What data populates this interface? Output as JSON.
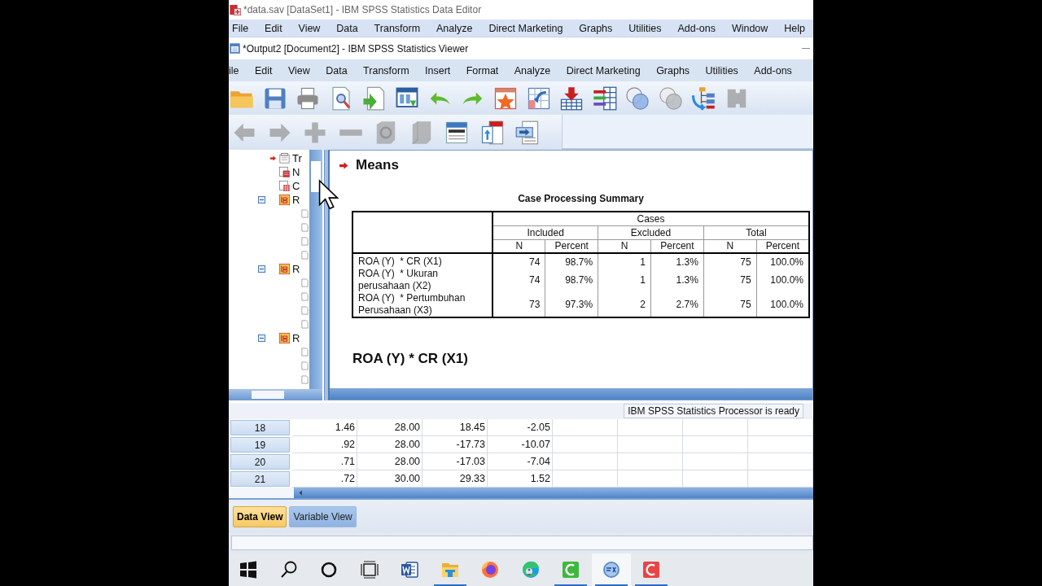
{
  "editor": {
    "title": "*data.sav [DataSet1] - IBM SPSS Statistics Data Editor",
    "menu": [
      "File",
      "Edit",
      "View",
      "Data",
      "Transform",
      "Analyze",
      "Direct Marketing",
      "Graphs",
      "Utilities",
      "Add-ons",
      "Window",
      "Help"
    ]
  },
  "viewer": {
    "title": "*Output2 [Document2] - IBM SPSS Statistics Viewer",
    "menu": [
      "ile",
      "Edit",
      "View",
      "Data",
      "Transform",
      "Insert",
      "Format",
      "Analyze",
      "Direct Marketing",
      "Graphs",
      "Utilities",
      "Add-ons"
    ],
    "toolbar": [
      {
        "kind": "open",
        "disabled": false
      },
      {
        "kind": "save",
        "disabled": false
      },
      {
        "kind": "print",
        "disabled": false
      },
      {
        "kind": "preview",
        "disabled": false
      },
      {
        "kind": "export",
        "disabled": false
      },
      {
        "kind": "dialog",
        "disabled": false
      },
      {
        "kind": "undo",
        "disabled": false
      },
      {
        "kind": "redo",
        "disabled": false
      },
      {
        "kind": "chart",
        "disabled": false
      },
      {
        "kind": "pivot",
        "disabled": false
      },
      {
        "kind": "insertvar",
        "disabled": false
      },
      {
        "kind": "varlist",
        "disabled": false
      },
      {
        "kind": "circles",
        "disabled": false
      },
      {
        "kind": "circles",
        "disabled": true
      },
      {
        "kind": "tree",
        "disabled": false
      },
      {
        "kind": "puzzle",
        "disabled": true
      }
    ],
    "toolbar2": [
      {
        "kind": "back",
        "disabled": true
      },
      {
        "kind": "forward",
        "disabled": true
      },
      {
        "kind": "plus",
        "disabled": true
      },
      {
        "kind": "minus",
        "disabled": true
      },
      {
        "kind": "zoombox",
        "disabled": true
      },
      {
        "kind": "box",
        "disabled": true
      },
      {
        "kind": "titlepanel",
        "disabled": false
      },
      {
        "kind": "pageup",
        "disabled": false
      },
      {
        "kind": "pageright",
        "disabled": false
      }
    ],
    "tree": [
      {
        "kind": "title",
        "label": "Tr",
        "selected": true
      },
      {
        "kind": "notes",
        "label": "N",
        "selected": false
      },
      {
        "kind": "case",
        "label": "C",
        "selected": false
      },
      {
        "kind": "group",
        "label": "R",
        "selected": false,
        "expanded": true,
        "children": [
          {
            "kind": "page"
          },
          {
            "kind": "page"
          },
          {
            "kind": "page"
          },
          {
            "kind": "page"
          }
        ]
      },
      {
        "kind": "group",
        "label": "R",
        "selected": false,
        "expanded": true,
        "children": [
          {
            "kind": "page"
          },
          {
            "kind": "page"
          },
          {
            "kind": "page"
          },
          {
            "kind": "page"
          }
        ]
      },
      {
        "kind": "group",
        "label": "R",
        "selected": false,
        "expanded": true,
        "children": [
          {
            "kind": "page"
          },
          {
            "kind": "page"
          },
          {
            "kind": "page"
          }
        ]
      }
    ],
    "output": {
      "heading": "Means",
      "marked": true,
      "table": {
        "title": "Case Processing Summary",
        "super_header": "Cases",
        "groups": [
          "Included",
          "Excluded",
          "Total"
        ],
        "sub_headers": [
          "N",
          "Percent",
          "N",
          "Percent",
          "N",
          "Percent"
        ],
        "rows": [
          {
            "label": "ROA (Y)  * CR (X1)",
            "cells": [
              "74",
              "98.7%",
              "1",
              "1.3%",
              "75",
              "100.0%"
            ]
          },
          {
            "label": "ROA (Y)  * Ukuran perusahaan (X2)",
            "cells": [
              "74",
              "98.7%",
              "1",
              "1.3%",
              "75",
              "100.0%"
            ]
          },
          {
            "label": "ROA (Y)  * Pertumbuhan Perusahaan (X3)",
            "cells": [
              "73",
              "97.3%",
              "2",
              "2.7%",
              "75",
              "100.0%"
            ]
          }
        ]
      },
      "subheading": "ROA (Y)  * CR (X1)"
    },
    "status": "IBM SPSS Statistics Processor is ready"
  },
  "grid": {
    "rows": [
      {
        "number": "18",
        "values": [
          "1.46",
          "28.00",
          "18.45",
          "-2.05"
        ]
      },
      {
        "number": "19",
        "values": [
          ".92",
          "28.00",
          "-17.73",
          "-10.07"
        ]
      },
      {
        "number": "20",
        "values": [
          ".71",
          "28.00",
          "-17.03",
          "-7.04"
        ]
      },
      {
        "number": "21",
        "values": [
          ".72",
          "30.00",
          "29.33",
          "1.52"
        ]
      }
    ]
  },
  "tabs": [
    {
      "label": "Data View",
      "selected": true
    },
    {
      "label": "Variable View",
      "selected": false
    }
  ],
  "taskbar": [
    {
      "kind": "start",
      "running": false,
      "active": false
    },
    {
      "kind": "search",
      "running": false,
      "active": false
    },
    {
      "kind": "cortana",
      "running": false,
      "active": false
    },
    {
      "kind": "taskview",
      "running": false,
      "active": false
    },
    {
      "kind": "word",
      "running": false,
      "active": false
    },
    {
      "kind": "folder",
      "running": true,
      "active": false
    },
    {
      "kind": "firefox",
      "running": false,
      "active": false
    },
    {
      "kind": "edge",
      "running": false,
      "active": false
    },
    {
      "kind": "greenc",
      "running": true,
      "active": false
    },
    {
      "kind": "spss",
      "running": true,
      "active": true
    },
    {
      "kind": "redc",
      "running": true,
      "active": false
    }
  ]
}
